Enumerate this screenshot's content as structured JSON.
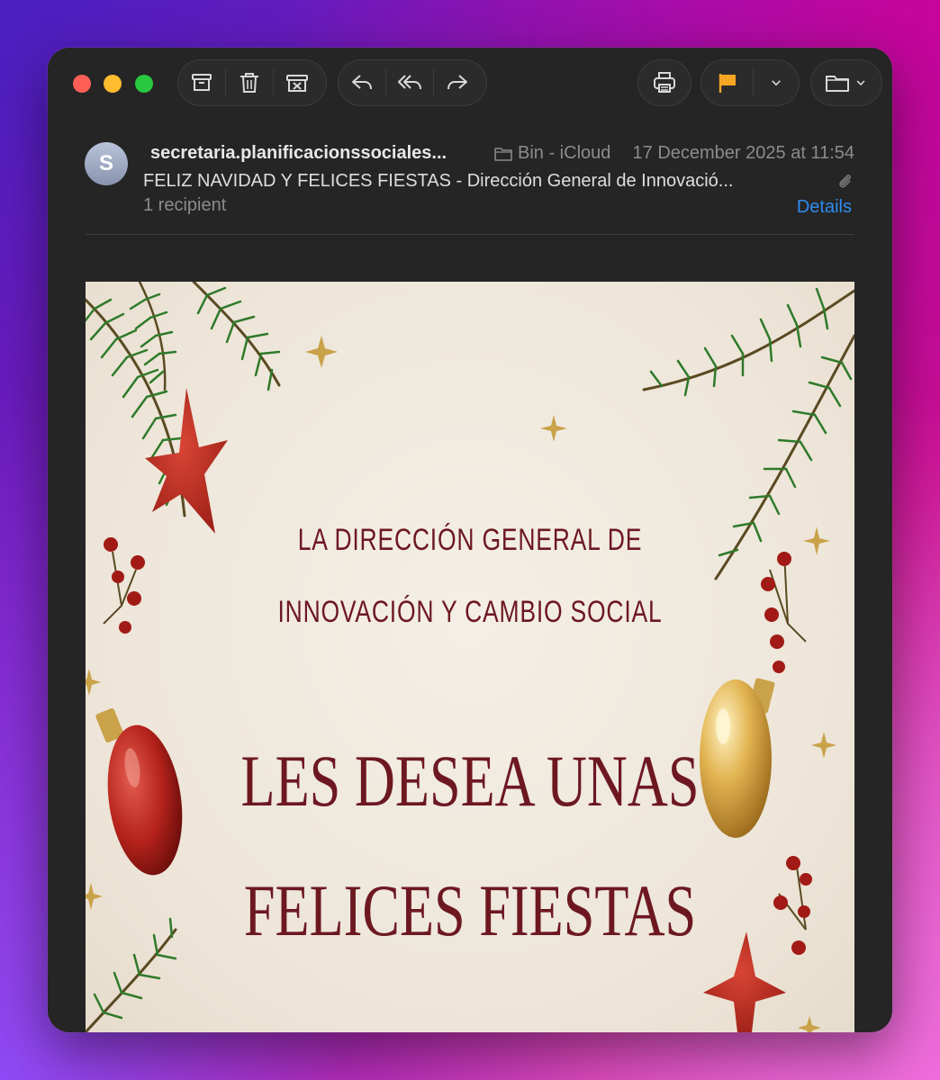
{
  "window": {
    "traffic_lights": [
      "close",
      "minimize",
      "zoom"
    ]
  },
  "toolbar": {
    "groups": [
      [
        "archive-icon",
        "trash-icon",
        "junk-icon"
      ],
      [
        "reply-icon",
        "reply-all-icon",
        "forward-icon"
      ],
      [
        "print-icon"
      ],
      [
        "flag-icon",
        "chevron-down-icon"
      ],
      [
        "move-to-folder-icon",
        "chevron-down-icon"
      ]
    ],
    "flag_color": "#f5a623"
  },
  "message": {
    "avatar_initial": "S",
    "sender": "secretaria.planificacionssociales...",
    "mailbox": "Bin - iCloud",
    "date": "17 December 2025 at 11:54",
    "subject": "FELIZ NAVIDAD Y FELICES FIESTAS - Dirección General de Innovació...",
    "recipients": "1 recipient",
    "details_label": "Details",
    "has_attachment": true
  },
  "body_image": {
    "line1": "LA DIRECCIÓN GENERAL DE",
    "line2": "INNOVACIÓN Y CAMBIO SOCIAL",
    "line3": "LES DESEA UNAS",
    "line4": "FELICES FIESTAS"
  },
  "colors": {
    "accent": "#2d8cf0",
    "greeting_text": "#6d1821",
    "window_bg": "#252525"
  }
}
